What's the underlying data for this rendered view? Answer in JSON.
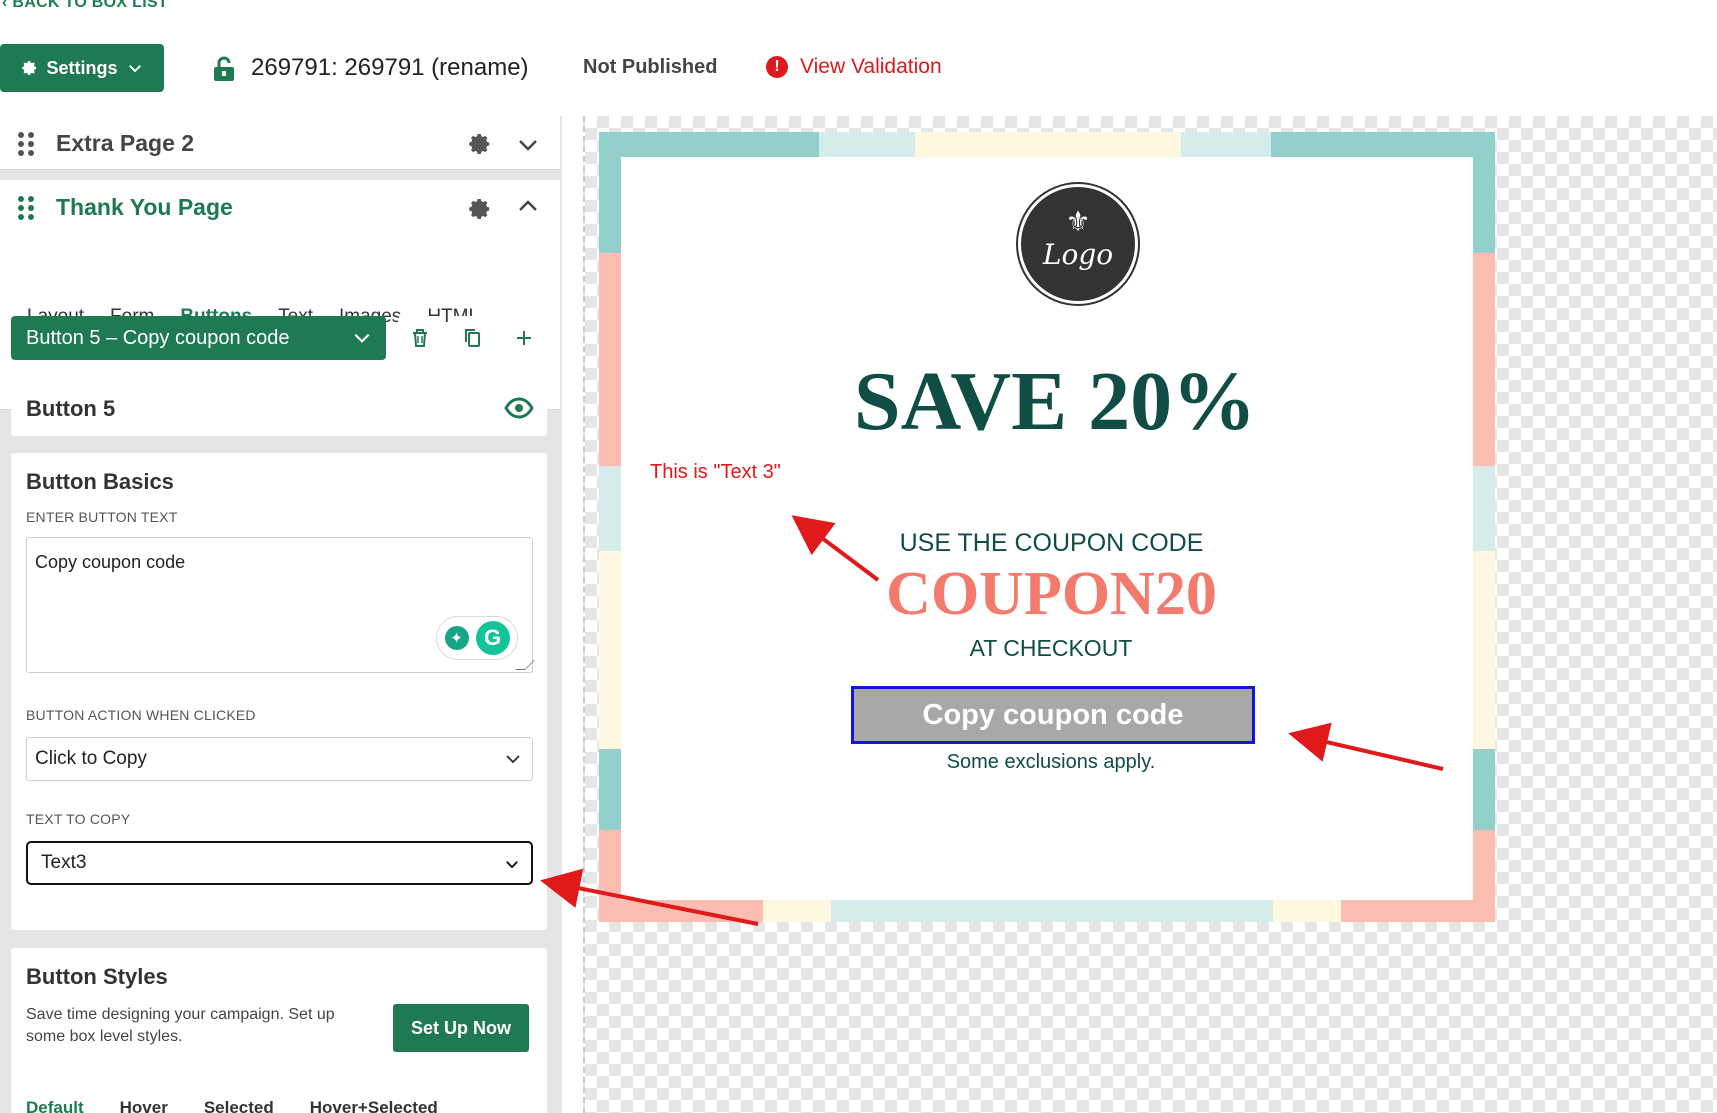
{
  "header": {
    "back_link": "‹ BACK TO BOX LIST",
    "settings_label": "Settings",
    "box_title": "269791: 269791 (rename)",
    "publish_status": "Not Published",
    "validation_label": "View Validation"
  },
  "sidebar": {
    "pages": [
      {
        "name": "Extra Page 2"
      },
      {
        "name": "Thank You Page"
      }
    ],
    "tabs": [
      "Layout",
      "Form",
      "Buttons",
      "Text",
      "Images",
      "HTML"
    ],
    "active_tab": "Buttons",
    "button_select_label": "Button 5 – Copy coupon code",
    "button_name": "Button 5",
    "basics": {
      "title": "Button Basics",
      "text_label": "ENTER BUTTON TEXT",
      "text_value": "Copy coupon code",
      "action_label": "BUTTON ACTION WHEN CLICKED",
      "action_value": "Click to Copy",
      "copy_label": "TEXT TO COPY",
      "copy_value": "Text3"
    },
    "styles": {
      "title": "Button Styles",
      "description": "Save time designing your campaign. Set up some box level styles.",
      "setup_label": "Set Up Now",
      "tabs": [
        "Default",
        "Hover",
        "Selected",
        "Hover+Selected"
      ]
    }
  },
  "preview": {
    "logo_text": "Logo",
    "headline": "SAVE 20%",
    "annotation": "This is \"Text 3\"",
    "use_code": "USE THE COUPON CODE",
    "coupon_code": "COUPON20",
    "checkout": "AT CHECKOUT",
    "copy_button": "Copy coupon code",
    "exclusions": "Some exclusions apply."
  },
  "colors": {
    "brand_green": "#1f7a53",
    "alert_red": "#e0191b",
    "headline_teal": "#0f4d45",
    "coupon_coral": "#f27b6e",
    "border_teal": "#93d0cc",
    "border_coral": "#fbbcb1",
    "border_cream": "#fff8e1",
    "border_mint": "#d4ecea",
    "copy_button_bg": "#a8a8a8",
    "copy_button_border": "#1515d8"
  },
  "icons": [
    "gear-icon",
    "chevron-down-icon",
    "lock-icon",
    "alert-icon",
    "drag-handle-icon",
    "chevron-up-icon",
    "trash-icon",
    "duplicate-icon",
    "plus-icon",
    "eye-icon",
    "grammarly-icon",
    "fleur-de-lis-icon"
  ]
}
